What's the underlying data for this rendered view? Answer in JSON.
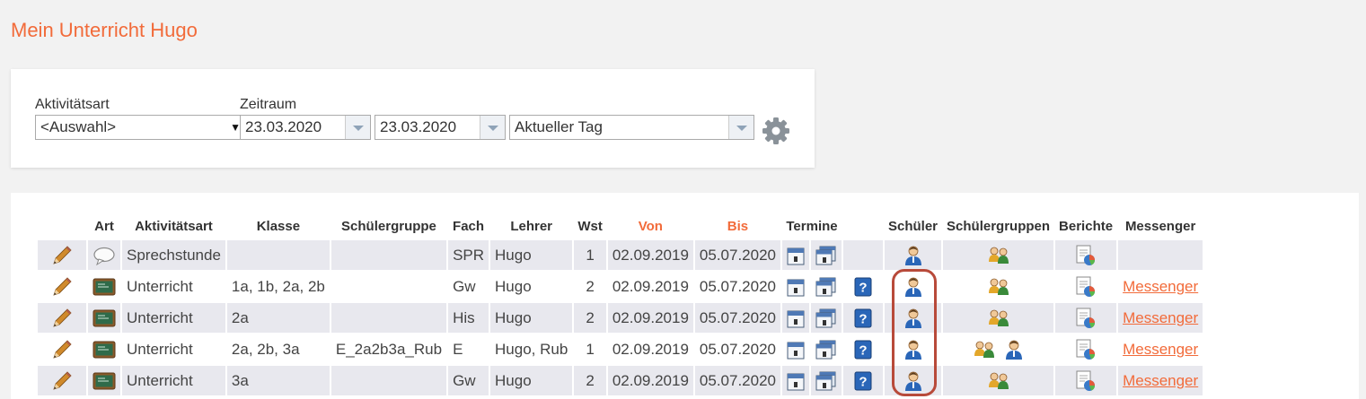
{
  "page": {
    "title": "Mein Unterricht Hugo"
  },
  "filters": {
    "aktivitaetsart_label": "Aktivitätsart",
    "aktivitaetsart_value": "<Auswahl>",
    "zeitraum_label": "Zeitraum",
    "date_from": "23.03.2020",
    "date_to": "23.03.2020",
    "period": "Aktueller Tag",
    "settings_icon": "gear-icon"
  },
  "table": {
    "headers": {
      "art": "Art",
      "aktivitaetsart": "Aktivitätsart",
      "klasse": "Klasse",
      "schuelergruppe": "Schülergruppe",
      "fach": "Fach",
      "lehrer": "Lehrer",
      "wst": "Wst",
      "von": "Von",
      "bis": "Bis",
      "termine": "Termine",
      "schueler": "Schüler",
      "schuelergruppen": "Schülergruppen",
      "berichte": "Berichte",
      "messenger": "Messenger"
    },
    "highlight_color": "#f26b3a",
    "rows": [
      {
        "type_icon": "speech-bubble-icon",
        "aktivitaetsart": "Sprechstunde",
        "klasse": "",
        "schuelergruppe": "",
        "fach": "SPR",
        "lehrer": "Hugo",
        "wst": "1",
        "von": "02.09.2019",
        "bis": "05.07.2020",
        "help": false,
        "extra_student": false,
        "messenger": ""
      },
      {
        "type_icon": "blackboard-icon",
        "aktivitaetsart": "Unterricht",
        "klasse": "1a, 1b, 2a, 2b",
        "schuelergruppe": "",
        "fach": "Gw",
        "lehrer": "Hugo",
        "wst": "2",
        "von": "02.09.2019",
        "bis": "05.07.2020",
        "help": true,
        "extra_student": false,
        "messenger": "Messenger"
      },
      {
        "type_icon": "blackboard-icon",
        "aktivitaetsart": "Unterricht",
        "klasse": "2a",
        "schuelergruppe": "",
        "fach": "His",
        "lehrer": "Hugo",
        "wst": "2",
        "von": "02.09.2019",
        "bis": "05.07.2020",
        "help": true,
        "extra_student": false,
        "messenger": "Messenger"
      },
      {
        "type_icon": "blackboard-icon",
        "aktivitaetsart": "Unterricht",
        "klasse": "2a, 2b, 3a",
        "schuelergruppe": "E_2a2b3a_Rub",
        "fach": "E",
        "lehrer": "Hugo, Rub",
        "wst": "1",
        "von": "02.09.2019",
        "bis": "05.07.2020",
        "help": true,
        "extra_student": true,
        "messenger": "Messenger"
      },
      {
        "type_icon": "blackboard-icon",
        "aktivitaetsart": "Unterricht",
        "klasse": "3a",
        "schuelergruppe": "",
        "fach": "Gw",
        "lehrer": "Hugo",
        "wst": "2",
        "von": "02.09.2019",
        "bis": "05.07.2020",
        "help": true,
        "extra_student": false,
        "messenger": "Messenger"
      }
    ]
  }
}
